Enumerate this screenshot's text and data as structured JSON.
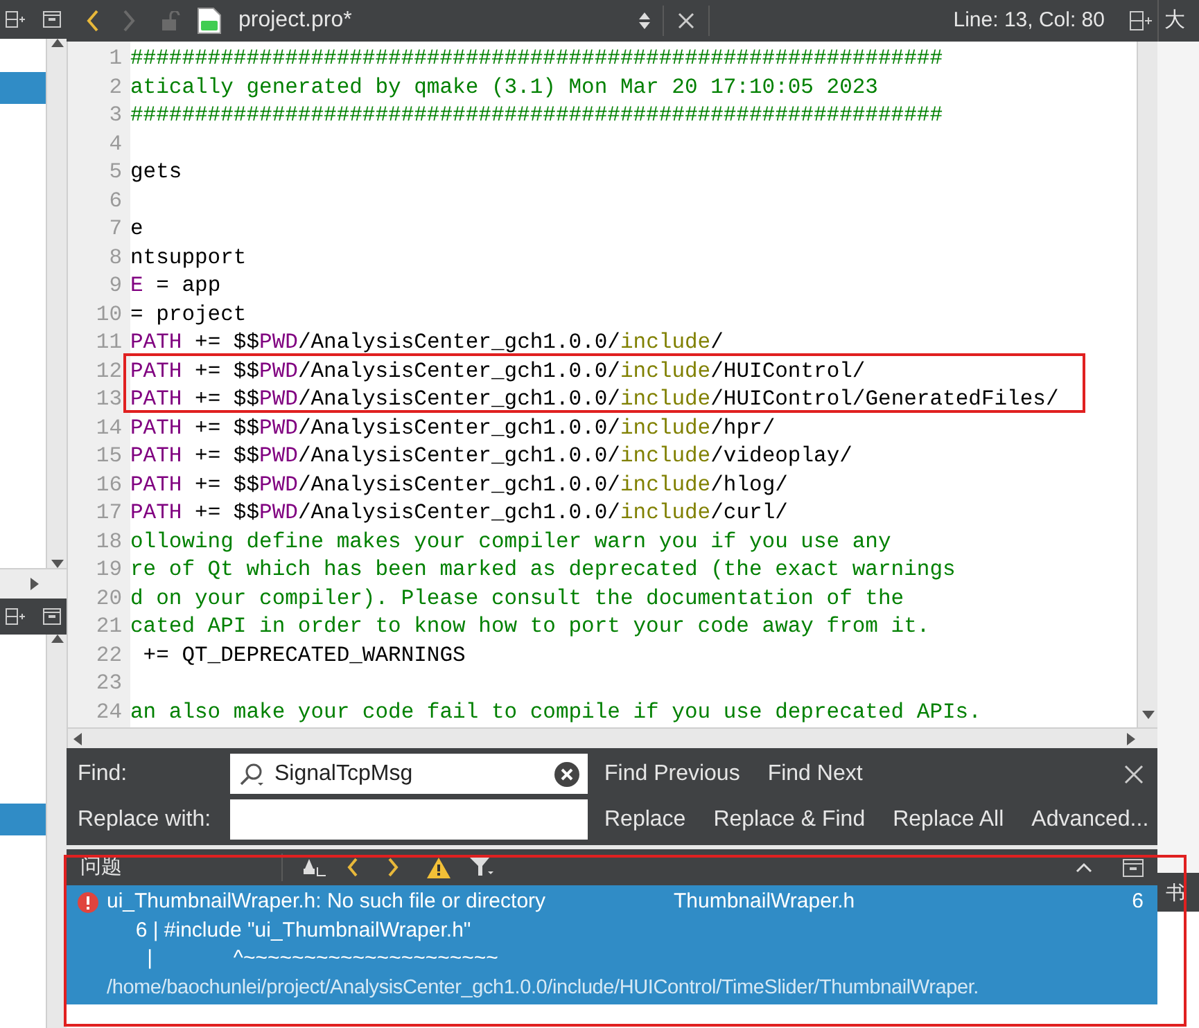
{
  "sidebar_top": {
    "rows": [
      {
        "selected": true
      }
    ]
  },
  "sidebar_bottom": {
    "rows": [
      {
        "selected": true
      }
    ]
  },
  "editor_toolbar": {
    "back_enabled": true,
    "forward_enabled": false,
    "file_name": "project.pro*",
    "cursor_position": "Line: 13, Col: 80",
    "side_label": "大"
  },
  "code_lines": [
    {
      "number": "1",
      "segments": [
        {
          "kind": "comment",
          "text": "###############################################################"
        }
      ]
    },
    {
      "number": "2",
      "segments": [
        {
          "kind": "comment",
          "text": "atically generated by qmake (3.1) Mon Mar 20 17:10:05 2023"
        }
      ]
    },
    {
      "number": "3",
      "segments": [
        {
          "kind": "comment",
          "text": "###############################################################"
        }
      ]
    },
    {
      "number": "4"
    },
    {
      "number": "5",
      "segments": [
        {
          "kind": "plain",
          "text": "gets"
        }
      ]
    },
    {
      "number": "6"
    },
    {
      "number": "7",
      "segments": [
        {
          "kind": "plain",
          "text": "e"
        }
      ]
    },
    {
      "number": "8",
      "segments": [
        {
          "kind": "plain",
          "text": "ntsupport"
        }
      ]
    },
    {
      "number": "9",
      "segments": [
        {
          "kind": "variable",
          "text": "E"
        },
        {
          "kind": "plain",
          "text": " = app"
        }
      ]
    },
    {
      "number": "10",
      "segments": [
        {
          "kind": "plain",
          "text": "= project"
        }
      ]
    },
    {
      "number": "11",
      "segments": [
        {
          "kind": "variable",
          "text": "PATH"
        },
        {
          "kind": "plain",
          "text": " += $$"
        },
        {
          "kind": "variable",
          "text": "PWD"
        },
        {
          "kind": "plain",
          "text": "/AnalysisCenter_gch1.0.0/"
        },
        {
          "kind": "function",
          "text": "include"
        },
        {
          "kind": "plain",
          "text": "/"
        }
      ]
    },
    {
      "number": "12",
      "segments": [
        {
          "kind": "variable",
          "text": "PATH"
        },
        {
          "kind": "plain",
          "text": " += $$"
        },
        {
          "kind": "variable",
          "text": "PWD"
        },
        {
          "kind": "plain",
          "text": "/AnalysisCenter_gch1.0.0/"
        },
        {
          "kind": "function",
          "text": "include"
        },
        {
          "kind": "plain",
          "text": "/HUIControl/"
        }
      ]
    },
    {
      "number": "13",
      "segments": [
        {
          "kind": "variable",
          "text": "PATH"
        },
        {
          "kind": "plain",
          "text": " += $$"
        },
        {
          "kind": "variable",
          "text": "PWD"
        },
        {
          "kind": "plain",
          "text": "/AnalysisCenter_gch1.0.0/"
        },
        {
          "kind": "function",
          "text": "include"
        },
        {
          "kind": "plain",
          "text": "/HUIControl/GeneratedFiles/"
        }
      ]
    },
    {
      "number": "14",
      "segments": [
        {
          "kind": "variable",
          "text": "PATH"
        },
        {
          "kind": "plain",
          "text": " += $$"
        },
        {
          "kind": "variable",
          "text": "PWD"
        },
        {
          "kind": "plain",
          "text": "/AnalysisCenter_gch1.0.0/"
        },
        {
          "kind": "function",
          "text": "include"
        },
        {
          "kind": "plain",
          "text": "/hpr/"
        }
      ]
    },
    {
      "number": "15",
      "segments": [
        {
          "kind": "variable",
          "text": "PATH"
        },
        {
          "kind": "plain",
          "text": " += $$"
        },
        {
          "kind": "variable",
          "text": "PWD"
        },
        {
          "kind": "plain",
          "text": "/AnalysisCenter_gch1.0.0/"
        },
        {
          "kind": "function",
          "text": "include"
        },
        {
          "kind": "plain",
          "text": "/videoplay/"
        }
      ]
    },
    {
      "number": "16",
      "segments": [
        {
          "kind": "variable",
          "text": "PATH"
        },
        {
          "kind": "plain",
          "text": " += $$"
        },
        {
          "kind": "variable",
          "text": "PWD"
        },
        {
          "kind": "plain",
          "text": "/AnalysisCenter_gch1.0.0/"
        },
        {
          "kind": "function",
          "text": "include"
        },
        {
          "kind": "plain",
          "text": "/hlog/"
        }
      ]
    },
    {
      "number": "17",
      "segments": [
        {
          "kind": "variable",
          "text": "PATH"
        },
        {
          "kind": "plain",
          "text": " += $$"
        },
        {
          "kind": "variable",
          "text": "PWD"
        },
        {
          "kind": "plain",
          "text": "/AnalysisCenter_gch1.0.0/"
        },
        {
          "kind": "function",
          "text": "include"
        },
        {
          "kind": "plain",
          "text": "/curl/"
        }
      ]
    },
    {
      "number": "18",
      "segments": [
        {
          "kind": "comment",
          "text": "ollowing define makes your compiler warn you if you use any"
        }
      ]
    },
    {
      "number": "19",
      "segments": [
        {
          "kind": "comment",
          "text": "re of Qt which has been marked as deprecated (the exact warnings"
        }
      ]
    },
    {
      "number": "20",
      "segments": [
        {
          "kind": "comment",
          "text": "d on your compiler). Please consult the documentation of the"
        }
      ]
    },
    {
      "number": "21",
      "segments": [
        {
          "kind": "comment",
          "text": "cated API in order to know how to port your code away from it."
        }
      ]
    },
    {
      "number": "22",
      "segments": [
        {
          "kind": "plain",
          "text": " += QT_DEPRECATED_WARNINGS"
        }
      ]
    },
    {
      "number": "23"
    },
    {
      "number": "24",
      "segments": [
        {
          "kind": "comment",
          "text": "an also make your code fail to compile if you use deprecated APIs."
        }
      ]
    }
  ],
  "find_bar": {
    "find_label": "Find:",
    "find_value": "SignalTcpMsg",
    "replace_label": "Replace with:",
    "buttons": [
      "Find Previous",
      "Find Next",
      "Replace",
      "Replace & Find",
      "Replace All",
      "Advanced..."
    ]
  },
  "issues_panel": {
    "title": "问题",
    "side_tab": "书",
    "issues": [
      {
        "selected": true,
        "message": "ui_ThumbnailWraper.h: No such file or directory",
        "file": "ThumbnailWraper.h",
        "line": "6",
        "details": [
          "     6 | #include \"ui_ThumbnailWraper.h\"",
          "       |              ^~~~~~~~~~~~~~~~~~~~~~",
          "/home/baochunlei/project/AnalysisCenter_gch1.0.0/include/HUIControl/TimeSlider/ThumbnailWraper."
        ]
      }
    ]
  }
}
